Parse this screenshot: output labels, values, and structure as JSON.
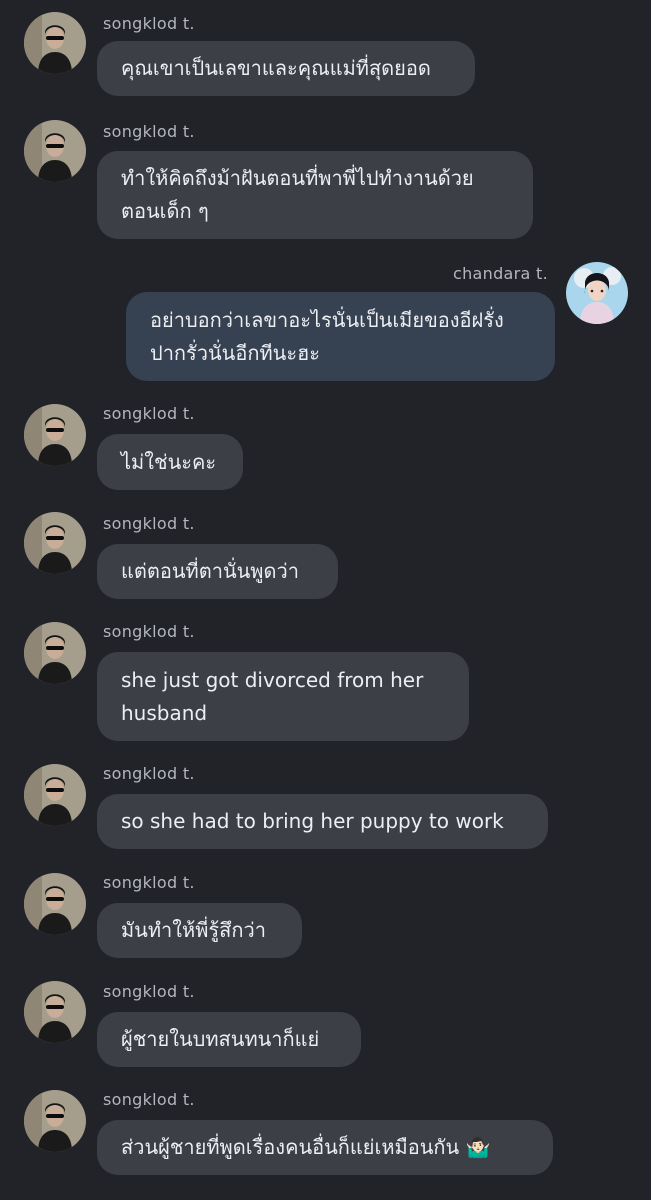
{
  "messages": [
    {
      "sender": "songklod t.",
      "side": "left",
      "text": "คุณเขาเป็นเลขาและคุณแม่ที่สุดยอด"
    },
    {
      "sender": "songklod t.",
      "side": "left",
      "text": "ทำให้คิดถึงม้าฝันตอนที่พาพี่ไปทำงานด้วย\nตอนเด็ก ๆ"
    },
    {
      "sender": "chandara t.",
      "side": "right",
      "text": "อย่าบอกว่าเลขาอะไรนั่นเป็นเมียของอีฝรั่ง\nปากรั่วนั่นอีกทีนะฮะ"
    },
    {
      "sender": "songklod t.",
      "side": "left",
      "text": "ไม่ใช่นะคะ"
    },
    {
      "sender": "songklod t.",
      "side": "left",
      "text": "แต่ตอนที่ตานั่นพูดว่า"
    },
    {
      "sender": "songklod t.",
      "side": "left",
      "text": "she just got divorced from her\nhusband"
    },
    {
      "sender": "songklod t.",
      "side": "left",
      "text": "so she had to bring her puppy to work"
    },
    {
      "sender": "songklod t.",
      "side": "left",
      "text": "มันทำให้พี่รู้สึกว่า"
    },
    {
      "sender": "songklod t.",
      "side": "left",
      "text": "ผู้ชายในบทสนทนาก็แย่"
    },
    {
      "sender": "songklod t.",
      "side": "left",
      "text": "ส่วนผู้ชายที่พูดเรื่องคนอื่นก็แย่เหมือนกัน 🤷🏻‍♂️"
    }
  ],
  "colors": {
    "background": "#212329",
    "bubble_incoming": "#3c3f46",
    "bubble_outgoing": "#364152",
    "sender_name": "#b3b6bd",
    "message_text": "#eceef2"
  }
}
